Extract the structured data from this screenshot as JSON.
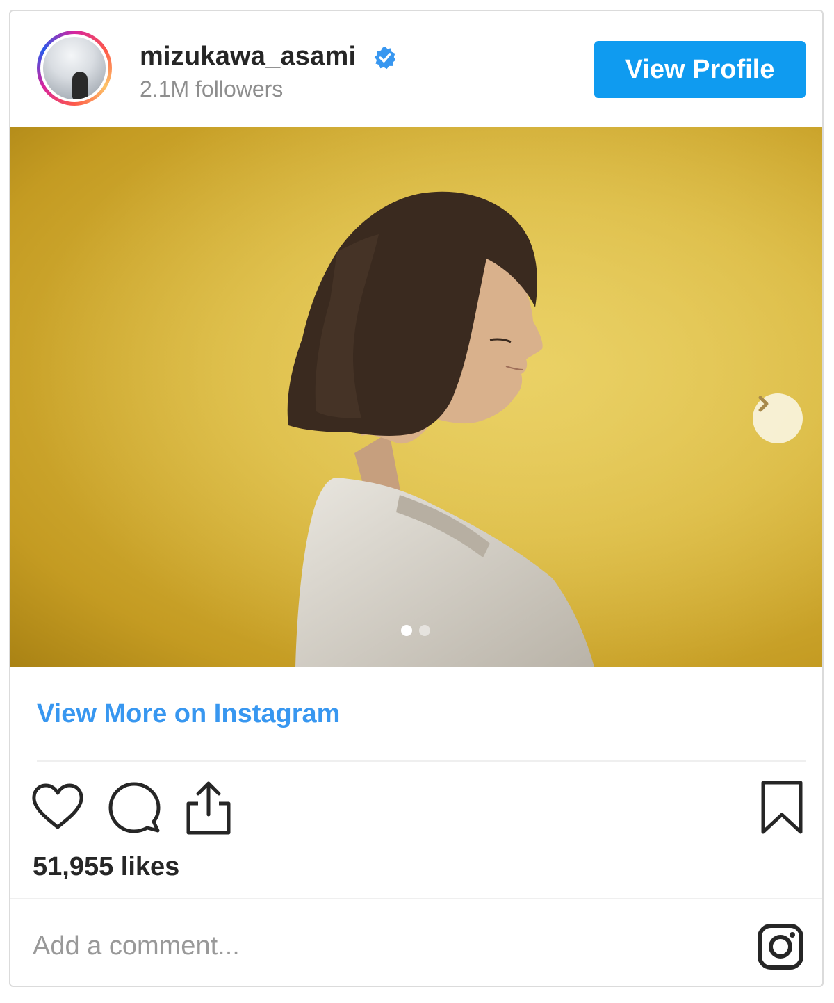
{
  "header": {
    "username": "mizukawa_asami",
    "followers": "2.1M followers",
    "view_profile_label": "View Profile"
  },
  "post": {
    "carousel_total": 2,
    "carousel_current": 1
  },
  "links": {
    "view_more_label": "View More on Instagram"
  },
  "stats": {
    "likes": "51,955 likes"
  },
  "comment": {
    "placeholder": "Add a comment..."
  },
  "colors": {
    "accent": "#3897f0",
    "button": "#0f9bf0",
    "verified": "#3897f0"
  }
}
